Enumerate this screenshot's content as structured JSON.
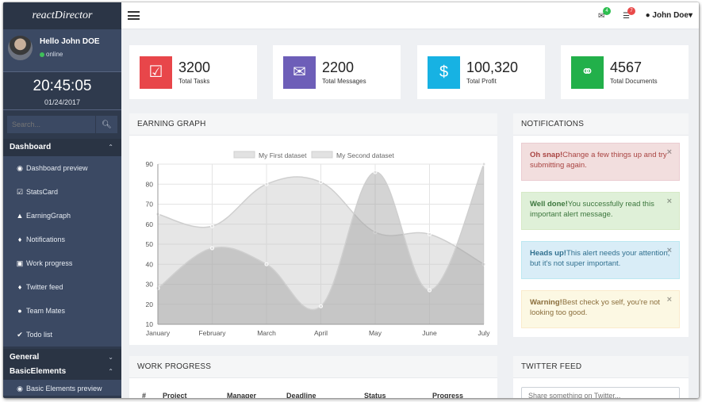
{
  "app": {
    "brand": "reactDirector"
  },
  "user": {
    "greeting": "Hello John DOE",
    "status": "online",
    "menu_label": "John Doe"
  },
  "clock": {
    "time": "20:45:05",
    "date": "01/24/2017"
  },
  "search": {
    "placeholder": "Search..."
  },
  "sidebar": {
    "dashboard_section": "Dashboard",
    "items": [
      {
        "label": "Dashboard preview",
        "icon": "eye-icon"
      },
      {
        "label": "StatsCard",
        "icon": "check-square-icon"
      },
      {
        "label": "EarningGraph",
        "icon": "area-chart-icon"
      },
      {
        "label": "Notifications",
        "icon": "bell-icon"
      },
      {
        "label": "Work progress",
        "icon": "briefcase-icon"
      },
      {
        "label": "Twitter feed",
        "icon": "twitter-icon"
      },
      {
        "label": "Team Mates",
        "icon": "user-icon"
      },
      {
        "label": "Todo list",
        "icon": "check-icon"
      }
    ],
    "general_section": "General",
    "basic_section": "BasicElements",
    "basic_item": "Basic Elements preview"
  },
  "topbar": {
    "mail_badge": "4",
    "list_badge": "7",
    "colors": {
      "mail_badge": "#2dbe4f",
      "list_badge": "#e94a4a"
    }
  },
  "stats": [
    {
      "value": "3200",
      "label": "Total Tasks",
      "color": "#e8464a",
      "icon": "check-square-icon"
    },
    {
      "value": "2200",
      "label": "Total Messages",
      "color": "#6d5eb8",
      "icon": "envelope-icon"
    },
    {
      "value": "100,320",
      "label": "Total Profit",
      "color": "#17b2e3",
      "icon": "dollar-icon"
    },
    {
      "value": "4567",
      "label": "Total Documents",
      "color": "#22b04a",
      "icon": "paperclip-icon"
    }
  ],
  "panels": {
    "earning": "EARNING GRAPH",
    "notifications": "NOTIFICATIONS",
    "work": "WORK PROGRESS",
    "twitter": "TWITTER FEED"
  },
  "chart_data": {
    "type": "area",
    "categories": [
      "January",
      "February",
      "March",
      "April",
      "May",
      "June",
      "July"
    ],
    "series": [
      {
        "name": "My First dataset",
        "values": [
          65,
          59,
          80,
          81,
          56,
          55,
          40
        ]
      },
      {
        "name": "My Second dataset",
        "values": [
          28,
          48,
          40,
          19,
          86,
          27,
          90
        ]
      }
    ],
    "ylim": [
      10,
      90
    ],
    "yticks": [
      10,
      20,
      30,
      40,
      50,
      60,
      70,
      80,
      90
    ],
    "grid": true,
    "legend": "top"
  },
  "alerts": [
    {
      "title": "Oh snap!",
      "text": "Change a few things up and try submitting again.",
      "bg": "#f2dede",
      "border": "#ebccd1",
      "fg": "#a94442"
    },
    {
      "title": "Well done!",
      "text": "You successfully read this important alert message.",
      "bg": "#dff0d8",
      "border": "#d6e9c6",
      "fg": "#3c763d"
    },
    {
      "title": "Heads up!",
      "text": "This alert needs your attention, but it's not super important.",
      "bg": "#d9edf7",
      "border": "#bce8f1",
      "fg": "#31708f"
    },
    {
      "title": "Warning!",
      "text": "Best check yo self, you're not looking too good.",
      "bg": "#fcf8e3",
      "border": "#faebcc",
      "fg": "#8a6d3b"
    }
  ],
  "alert_close": "×",
  "work_table": {
    "columns": [
      "#",
      "Project",
      "Manager",
      "Deadline",
      "Status",
      "Progress"
    ]
  },
  "twitter": {
    "placeholder": "Share something on Twitter..."
  }
}
